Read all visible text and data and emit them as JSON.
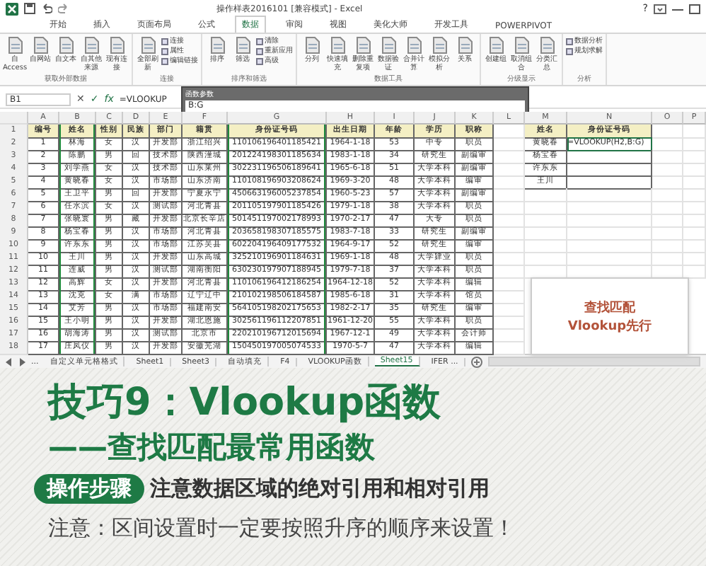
{
  "window": {
    "title": "操作样表2016101 [兼容模式] - Excel",
    "help": "?"
  },
  "ribbon": {
    "tabs": [
      {
        "label": "开始",
        "selected": false
      },
      {
        "label": "插入",
        "selected": false
      },
      {
        "label": "页面布局",
        "selected": false
      },
      {
        "label": "公式",
        "selected": false
      },
      {
        "label": "数据",
        "selected": true
      },
      {
        "label": "审阅",
        "selected": false
      },
      {
        "label": "视图",
        "selected": false
      },
      {
        "label": "美化大师",
        "selected": false
      },
      {
        "label": "开发工具",
        "selected": false
      },
      {
        "label": "POWERPIVOT",
        "selected": false
      }
    ],
    "groups": [
      {
        "label": "获取外部数据",
        "large": [
          "自 Access",
          "自网站",
          "自文本",
          "自其他来源",
          "现有连接"
        ]
      },
      {
        "label": "连接",
        "large": [
          "全部刷新"
        ],
        "small": [
          "连接",
          "属性",
          "编辑链接"
        ]
      },
      {
        "label": "排序和筛选",
        "large": [
          "排序",
          "筛选"
        ],
        "small": [
          "清除",
          "重新应用",
          "高级"
        ]
      },
      {
        "label": "数据工具",
        "large": [
          "分列",
          "快速填充",
          "删除重复项",
          "数据验证",
          "合并计算",
          "模拟分析",
          "关系"
        ]
      },
      {
        "label": "分级显示",
        "large": [
          "创建组",
          "取消组合",
          "分类汇总"
        ]
      },
      {
        "label": "分析",
        "small": [
          "数据分析",
          "规划求解"
        ]
      }
    ]
  },
  "formula_bar": {
    "name_box": "B1",
    "cancel": "✕",
    "enter": "✓",
    "fx": "fx",
    "formula": "=VLOOKUP"
  },
  "dialog": {
    "title": "函数参数",
    "field": "B:G"
  },
  "sheet": {
    "column_letters": [
      "A",
      "B",
      "C",
      "D",
      "E",
      "F",
      "G",
      "H",
      "I",
      "J",
      "K",
      "L",
      "M",
      "N",
      "O",
      "P"
    ],
    "row_numbers": [
      "1",
      "2",
      "3",
      "4",
      "5",
      "6",
      "7",
      "8",
      "9",
      "10",
      "11",
      "12",
      "13",
      "14",
      "15",
      "16",
      "17",
      "18"
    ]
  },
  "table": {
    "columns": [
      {
        "label": "编号",
        "marked": false
      },
      {
        "label": "姓名",
        "marked": true
      },
      {
        "label": "性别",
        "marked": false
      },
      {
        "label": "民族",
        "marked": false
      },
      {
        "label": "部门",
        "marked": false
      },
      {
        "label": "籍贯",
        "marked": false
      },
      {
        "label": "身份证号码",
        "marked": true
      },
      {
        "label": "出生日期",
        "marked": false
      },
      {
        "label": "年龄",
        "marked": false
      },
      {
        "label": "学历",
        "marked": false
      },
      {
        "label": "职称",
        "marked": false
      }
    ],
    "rows": [
      [
        "1",
        "林海",
        "女",
        "汉",
        "开发部",
        "浙江绍兴",
        "110106196401185421",
        "1964-1-18",
        "53",
        "中专",
        "职员"
      ],
      [
        "2",
        "陈鹏",
        "男",
        "回",
        "技术部",
        "陕西潼城",
        "201224198301185634",
        "1983-1-18",
        "34",
        "研究生",
        "副编审"
      ],
      [
        "3",
        "刘学燕",
        "女",
        "汉",
        "技术部",
        "山东莱州",
        "302231196506189641",
        "1965-6-18",
        "51",
        "大学本科",
        "副编审"
      ],
      [
        "4",
        "黄晓春",
        "女",
        "汉",
        "市场部",
        "山东济南",
        "110108196903208624",
        "1969-3-20",
        "48",
        "大学本科",
        "编审"
      ],
      [
        "5",
        "王卫平",
        "男",
        "回",
        "开发部",
        "宁夏永宁",
        "450663196005237854",
        "1960-5-23",
        "57",
        "大学本科",
        "副编审"
      ],
      [
        "6",
        "任水滨",
        "女",
        "汉",
        "测试部",
        "河北青县",
        "201105197901185426",
        "1979-1-18",
        "38",
        "大学本科",
        "职员"
      ],
      [
        "7",
        "张晓寰",
        "男",
        "藏",
        "开发部",
        "北京长辛店",
        "501451197002178993",
        "1970-2-17",
        "47",
        "大专",
        "职员"
      ],
      [
        "8",
        "杨宝春",
        "男",
        "汉",
        "市场部",
        "河北青县",
        "203658198307185575",
        "1983-7-18",
        "33",
        "研究生",
        "副编审"
      ],
      [
        "9",
        "许东东",
        "男",
        "汉",
        "市场部",
        "江苏吴县",
        "602204196409177532",
        "1964-9-17",
        "52",
        "研究生",
        "编审"
      ],
      [
        "10",
        "王川",
        "男",
        "汉",
        "开发部",
        "山东高城",
        "325210196901184631",
        "1969-1-18",
        "48",
        "大学肄业",
        "职员"
      ],
      [
        "11",
        "连威",
        "男",
        "汉",
        "测试部",
        "湖南衡阳",
        "630230197907188945",
        "1979-7-18",
        "37",
        "大学本科",
        "职员"
      ],
      [
        "12",
        "高辉",
        "女",
        "汉",
        "开发部",
        "河北青县",
        "110106196412186254",
        "1964-12-18",
        "52",
        "大学本科",
        "编辑"
      ],
      [
        "13",
        "沈克",
        "女",
        "满",
        "市场部",
        "辽宁辽中",
        "210102198506184587",
        "1985-6-18",
        "31",
        "大学本科",
        "馆员"
      ],
      [
        "14",
        "艾芳",
        "男",
        "汉",
        "市场部",
        "福建南安",
        "564105198202175653",
        "1982-2-17",
        "35",
        "研究生",
        "编审"
      ],
      [
        "15",
        "王小明",
        "男",
        "汉",
        "开发部",
        "湖北恩施",
        "302561196112207851",
        "1961-12-20",
        "55",
        "大学本科",
        "职员"
      ],
      [
        "16",
        "胡海涛",
        "男",
        "汉",
        "测试部",
        "北京市",
        "220210196712015694",
        "1967-12-1",
        "49",
        "大学本科",
        "会计师"
      ],
      [
        "17",
        "庄凤仪",
        "男",
        "汉",
        "开发部",
        "安徽芜湖",
        "150450197005074533",
        "1970-5-7",
        "47",
        "大学本科",
        "编辑"
      ]
    ]
  },
  "lookup": {
    "columns": [
      "姓名",
      "身份证号码"
    ],
    "rows": [
      {
        "name": "黄晓春",
        "value": "=VLOOKUP(H2,B:G)",
        "selected": true
      },
      {
        "name": "杨宝春",
        "selected": false
      },
      {
        "name": "许东东",
        "selected": false
      },
      {
        "name": "王川",
        "selected": false
      }
    ]
  },
  "note": {
    "lines": [
      "查找匹配",
      "Vlookup先行"
    ]
  },
  "sheet_tabs": {
    "more": "...",
    "tabs": [
      {
        "label": "自定义单元格格式",
        "selected": false
      },
      {
        "label": "Sheet1",
        "selected": false
      },
      {
        "label": "Sheet3",
        "selected": false
      },
      {
        "label": "自动填充",
        "selected": false
      },
      {
        "label": "F4",
        "selected": false
      },
      {
        "label": "VLOOKUP函数",
        "selected": false
      },
      {
        "label": "Sheet15",
        "selected": true
      },
      {
        "label": "IFER ...",
        "selected": false
      }
    ]
  },
  "banner": {
    "title": "技巧9：Vlookup函数",
    "subtitle": "——查找匹配最常用函数",
    "step_badge": "操作步骤",
    "step_text": "注意数据区域的绝对引用和相对引用",
    "note": "注意：区间设置时一定要按照升序的顺序来设置！"
  }
}
